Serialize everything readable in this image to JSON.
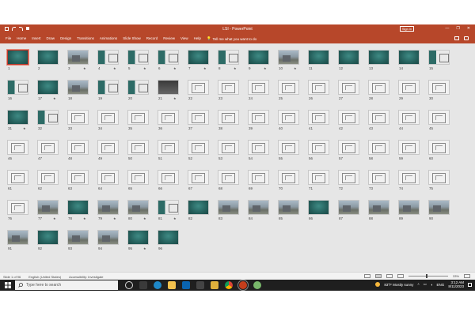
{
  "window": {
    "title": "LSI - PowerPoint",
    "signin_label": "Sign in",
    "minimize": "—",
    "maximize": "❐",
    "close": "✕"
  },
  "ribbon": {
    "tabs": [
      "File",
      "Home",
      "Insert",
      "Draw",
      "Design",
      "Transitions",
      "Animations",
      "Slide Show",
      "Record",
      "Review",
      "View",
      "Help"
    ],
    "tell_me": "Tell me what you want to do"
  },
  "slides": [
    {
      "n": "1",
      "kind": "teal",
      "star": false,
      "selected": true
    },
    {
      "n": "2",
      "kind": "teal",
      "star": false
    },
    {
      "n": "3",
      "kind": "photo",
      "star": true
    },
    {
      "n": "4",
      "kind": "mixed",
      "star": true
    },
    {
      "n": "5",
      "kind": "mixed",
      "star": true
    },
    {
      "n": "6",
      "kind": "mixed",
      "star": true
    },
    {
      "n": "7",
      "kind": "teal",
      "star": true
    },
    {
      "n": "8",
      "kind": "mixed",
      "star": true
    },
    {
      "n": "9",
      "kind": "teal",
      "star": true
    },
    {
      "n": "10",
      "kind": "photo",
      "star": true
    },
    {
      "n": "11",
      "kind": "teal",
      "star": false
    },
    {
      "n": "12",
      "kind": "teal",
      "star": false
    },
    {
      "n": "13",
      "kind": "teal",
      "star": false
    },
    {
      "n": "14",
      "kind": "teal",
      "star": false
    },
    {
      "n": "15",
      "kind": "mixed",
      "star": false
    },
    {
      "n": "16",
      "kind": "mixed",
      "star": false
    },
    {
      "n": "17",
      "kind": "teal",
      "star": true
    },
    {
      "n": "18",
      "kind": "photo",
      "star": false
    },
    {
      "n": "19",
      "kind": "mixed",
      "star": false
    },
    {
      "n": "20",
      "kind": "mixed",
      "star": false
    },
    {
      "n": "21",
      "kind": "dark",
      "star": true
    },
    {
      "n": "22",
      "kind": "plan",
      "star": false
    },
    {
      "n": "23",
      "kind": "plan",
      "star": false
    },
    {
      "n": "24",
      "kind": "plan",
      "star": false
    },
    {
      "n": "25",
      "kind": "plan",
      "star": false
    },
    {
      "n": "26",
      "kind": "plan",
      "star": false
    },
    {
      "n": "27",
      "kind": "plan",
      "star": false
    },
    {
      "n": "28",
      "kind": "plan",
      "star": false
    },
    {
      "n": "29",
      "kind": "plan",
      "star": false
    },
    {
      "n": "30",
      "kind": "plan",
      "star": false
    },
    {
      "n": "31",
      "kind": "teal",
      "star": true
    },
    {
      "n": "32",
      "kind": "mixed",
      "star": false
    },
    {
      "n": "33",
      "kind": "plan",
      "star": false
    },
    {
      "n": "34",
      "kind": "plan",
      "star": false
    },
    {
      "n": "35",
      "kind": "plan",
      "star": false
    },
    {
      "n": "36",
      "kind": "plan",
      "star": false
    },
    {
      "n": "37",
      "kind": "plan",
      "star": false
    },
    {
      "n": "38",
      "kind": "plan",
      "star": false
    },
    {
      "n": "39",
      "kind": "plan",
      "star": false
    },
    {
      "n": "40",
      "kind": "plan",
      "star": false
    },
    {
      "n": "41",
      "kind": "plan",
      "star": false
    },
    {
      "n": "42",
      "kind": "plan",
      "star": false
    },
    {
      "n": "43",
      "kind": "plan",
      "star": false
    },
    {
      "n": "44",
      "kind": "plan",
      "star": false
    },
    {
      "n": "45",
      "kind": "plan",
      "star": false
    },
    {
      "n": "46",
      "kind": "plan",
      "star": false
    },
    {
      "n": "47",
      "kind": "plan",
      "star": false
    },
    {
      "n": "48",
      "kind": "plan",
      "star": false
    },
    {
      "n": "49",
      "kind": "plan",
      "star": false
    },
    {
      "n": "50",
      "kind": "plan",
      "star": false
    },
    {
      "n": "51",
      "kind": "plan",
      "star": false
    },
    {
      "n": "52",
      "kind": "plan",
      "star": false
    },
    {
      "n": "53",
      "kind": "plan",
      "star": false
    },
    {
      "n": "54",
      "kind": "plan",
      "star": false
    },
    {
      "n": "55",
      "kind": "plan",
      "star": false
    },
    {
      "n": "56",
      "kind": "plan",
      "star": false
    },
    {
      "n": "57",
      "kind": "plan",
      "star": false
    },
    {
      "n": "58",
      "kind": "plan",
      "star": false
    },
    {
      "n": "59",
      "kind": "plan",
      "star": false
    },
    {
      "n": "60",
      "kind": "plan",
      "star": false
    },
    {
      "n": "61",
      "kind": "plan",
      "star": false
    },
    {
      "n": "62",
      "kind": "plan",
      "star": false
    },
    {
      "n": "63",
      "kind": "plan",
      "star": false
    },
    {
      "n": "64",
      "kind": "plan",
      "star": false
    },
    {
      "n": "65",
      "kind": "plan",
      "star": false
    },
    {
      "n": "66",
      "kind": "plan",
      "star": false
    },
    {
      "n": "67",
      "kind": "plan",
      "star": false
    },
    {
      "n": "68",
      "kind": "plan",
      "star": false
    },
    {
      "n": "69",
      "kind": "plan",
      "star": false
    },
    {
      "n": "70",
      "kind": "plan",
      "star": false
    },
    {
      "n": "71",
      "kind": "plan",
      "star": false
    },
    {
      "n": "72",
      "kind": "plan",
      "star": false
    },
    {
      "n": "73",
      "kind": "plan",
      "star": false
    },
    {
      "n": "74",
      "kind": "plan",
      "star": false
    },
    {
      "n": "75",
      "kind": "plan",
      "star": false
    },
    {
      "n": "76",
      "kind": "plan",
      "star": false
    },
    {
      "n": "77",
      "kind": "photo",
      "star": true
    },
    {
      "n": "78",
      "kind": "teal",
      "star": true
    },
    {
      "n": "79",
      "kind": "photo",
      "star": true
    },
    {
      "n": "80",
      "kind": "photo",
      "star": true
    },
    {
      "n": "81",
      "kind": "mixed",
      "star": true
    },
    {
      "n": "82",
      "kind": "teal",
      "star": false
    },
    {
      "n": "83",
      "kind": "photo",
      "star": false
    },
    {
      "n": "84",
      "kind": "photo",
      "star": false
    },
    {
      "n": "85",
      "kind": "photo",
      "star": false
    },
    {
      "n": "86",
      "kind": "teal",
      "star": false
    },
    {
      "n": "87",
      "kind": "photo",
      "star": false
    },
    {
      "n": "88",
      "kind": "photo",
      "star": false
    },
    {
      "n": "89",
      "kind": "photo",
      "star": false
    },
    {
      "n": "90",
      "kind": "photo",
      "star": false
    },
    {
      "n": "91",
      "kind": "photo",
      "star": false
    },
    {
      "n": "92",
      "kind": "teal",
      "star": false
    },
    {
      "n": "93",
      "kind": "photo",
      "star": false
    },
    {
      "n": "94",
      "kind": "photo",
      "star": false
    },
    {
      "n": "95",
      "kind": "teal",
      "star": true
    },
    {
      "n": "96",
      "kind": "teal",
      "star": false
    }
  ],
  "status": {
    "slide_info": "Slide 1 of 96",
    "language": "English (United States)",
    "accessibility": "Accessibility: Investigate",
    "zoom": "33%"
  },
  "taskbar": {
    "search_placeholder": "Type here to search",
    "weather": "83°F  Mostly sunny",
    "lang": "ENG",
    "time": "3:12 AM",
    "date": "8/11/2023"
  },
  "colors": {
    "accent": "#b7472a",
    "sorter_bg": "#e6e6e6",
    "teal_slide": "#2d6b66"
  }
}
